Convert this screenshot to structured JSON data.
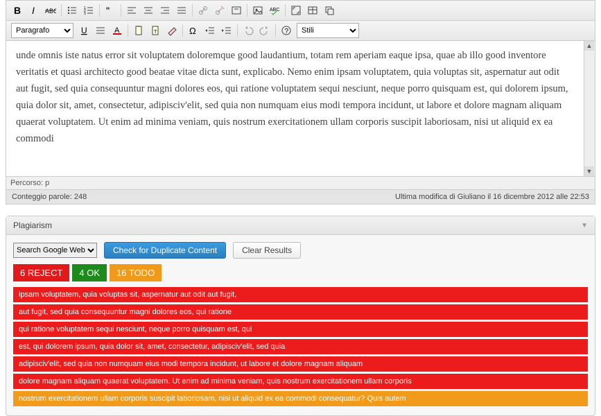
{
  "toolbar": {
    "format_select": "Paragrafo",
    "style_select": "Stili"
  },
  "icons": {
    "bold": "bold-icon",
    "italic": "italic-icon",
    "strike": "strike-icon",
    "ul": "ul-icon",
    "ol": "ol-icon",
    "quote": "quote-icon",
    "left": "align-left-icon",
    "center": "align-center-icon",
    "right": "align-right-icon",
    "justify": "align-justify-icon",
    "link": "link-icon",
    "unlink": "unlink-icon",
    "more": "more-icon",
    "image": "image-icon",
    "abc": "spellcheck-icon",
    "fullscreen": "fullscreen-icon",
    "table": "table-icon",
    "restore": "restore-icon",
    "underline": "underline-icon",
    "align": "align-icon",
    "fontcolor": "fontcolor-icon",
    "paste": "paste-icon",
    "pastetext": "paste-text-icon",
    "clear": "clear-format-icon",
    "omega": "special-char-icon",
    "outdent": "outdent-icon",
    "indent": "indent-icon",
    "undo": "undo-icon",
    "redo": "redo-icon",
    "help": "help-icon"
  },
  "editor_text": "unde omnis iste natus error sit voluptatem doloremque good laudantium, totam rem aperiam eaque ipsa, quae ab illo good inventore veritatis et quasi architecto good beatae vitae dicta sunt, explicabo. Nemo enim ipsam voluptatem, quia voluptas sit, aspernatur aut odit aut fugit, sed quia consequuntur magni dolores eos, qui ratione voluptatem sequi nesciunt, neque porro quisquam est, qui dolorem ipsum, quia dolor sit, amet, consectetur, adipisciv'elit, sed quia non numquam eius modi tempora incidunt, ut labore et dolore magnam aliquam quaerat voluptatem. Ut enim ad minima veniam, quis nostrum exercitationem ullam corporis suscipit laboriosam, nisi ut aliquid ex ea commodi",
  "path": {
    "label": "Percorso: p"
  },
  "status": {
    "wordcount": "Conteggio parole: 248",
    "lastedit": "Ultima modifica di Giuliano il 16 dicembre 2012 alle 22:53"
  },
  "plagiarism": {
    "title": "Plagiarism",
    "search_select": "Search Google Web",
    "check_btn": "Check for Duplicate Content",
    "clear_btn": "Clear Results",
    "badges": {
      "reject": "6 REJECT",
      "ok": "4 OK",
      "todo": "16 TODO"
    },
    "results": [
      {
        "text": "ipsam voluptatem, quia voluptas sit, aspernatur aut odit aut fugit,",
        "type": "red"
      },
      {
        "text": "aut fugit, sed quia consequuntur magni dolores eos, qui ratione",
        "type": "red"
      },
      {
        "text": "qui ratione voluptatem sequi nesciunt, neque porro quisquam est, qui",
        "type": "red"
      },
      {
        "text": "est, qui dolorem ipsum, quia dolor sit, amet, consectetur, adipisciv'elit, sed quia",
        "type": "red"
      },
      {
        "text": "adipisciv'elit, sed quia non numquam eius modi tempora incidunt, ut labore et dolore magnam aliquam",
        "type": "red"
      },
      {
        "text": "dolore magnam aliquam quaerat voluptatem. Ut enim ad minima veniam, quis nostrum exercitationem ullam corporis",
        "type": "red"
      },
      {
        "text": "nostrum exercitationem ullam corporis suscipit laboriosam, nisi ut aliquid ex ea commodi consequatur? Quis autem",
        "type": "orange"
      }
    ]
  }
}
